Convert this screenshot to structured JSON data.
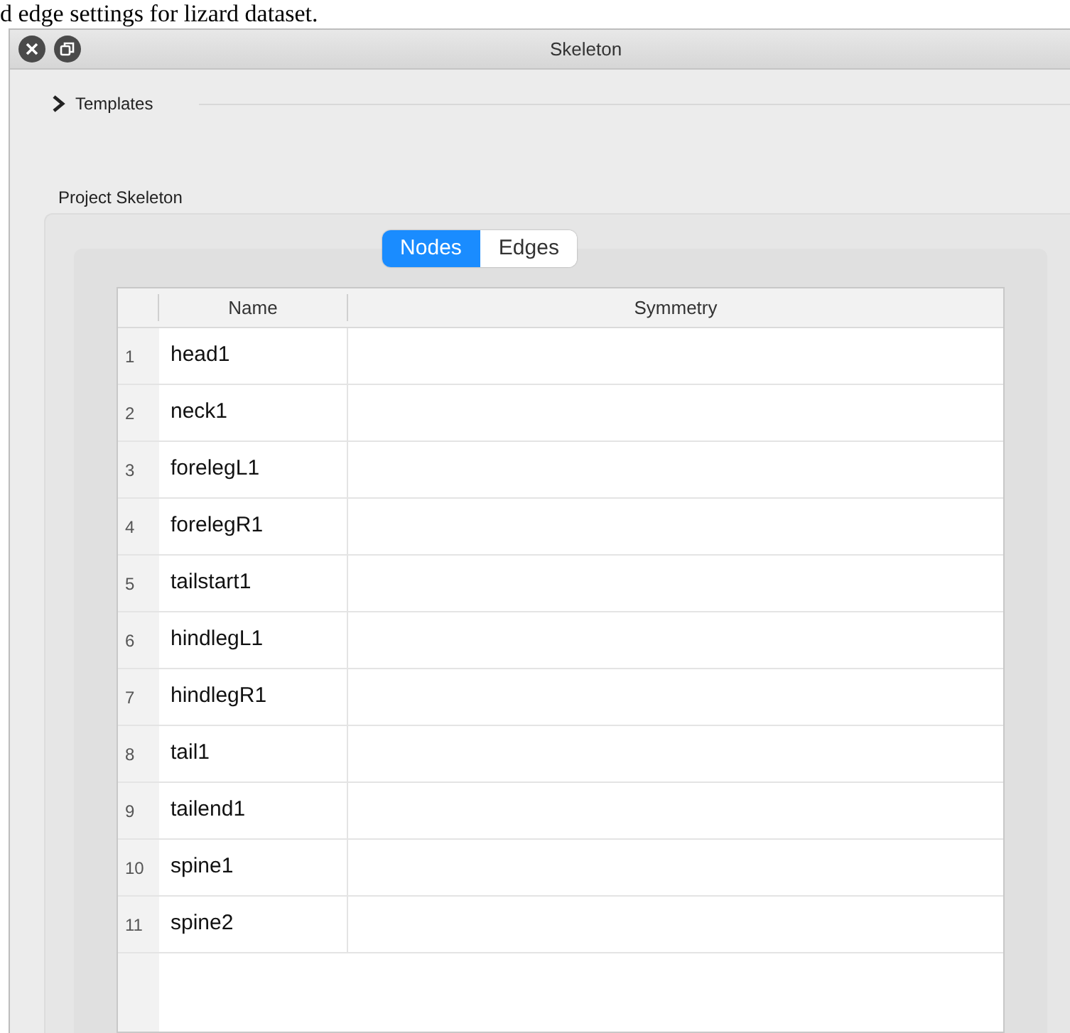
{
  "caption": "d edge settings for lizard dataset.",
  "window": {
    "title": "Skeleton"
  },
  "templates": {
    "label": "Templates",
    "expanded": false
  },
  "group": {
    "title": "Project Skeleton"
  },
  "tabs": [
    {
      "label": "Nodes",
      "selected": true
    },
    {
      "label": "Edges",
      "selected": false
    }
  ],
  "table": {
    "columns": [
      "Name",
      "Symmetry"
    ],
    "rows": [
      {
        "index": "1",
        "name": "head1"
      },
      {
        "index": "2",
        "name": "neck1"
      },
      {
        "index": "3",
        "name": "forelegL1"
      },
      {
        "index": "4",
        "name": "forelegR1"
      },
      {
        "index": "5",
        "name": "tailstart1"
      },
      {
        "index": "6",
        "name": "hindlegL1"
      },
      {
        "index": "7",
        "name": "hindlegR1"
      },
      {
        "index": "8",
        "name": "tail1"
      },
      {
        "index": "9",
        "name": "tailend1"
      },
      {
        "index": "10",
        "name": "spine1"
      },
      {
        "index": "11",
        "name": "spine2"
      }
    ]
  }
}
